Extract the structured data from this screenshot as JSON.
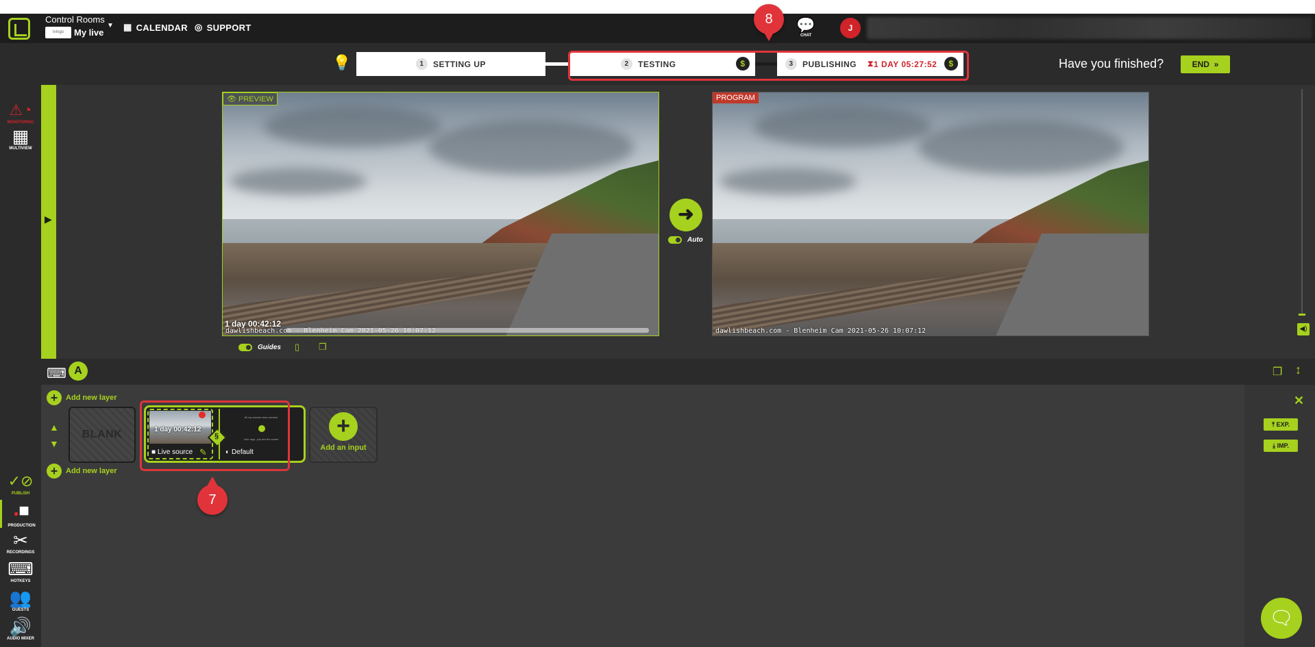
{
  "header": {
    "room_title": "Control Rooms",
    "room_name": "My live",
    "calendar_label": "CALENDAR",
    "support_label": "SUPPORT",
    "chat_label": "CHAT",
    "avatar_initial": "J"
  },
  "steps": [
    {
      "number": "1",
      "label": "SETTING UP"
    },
    {
      "number": "2",
      "label": "TESTING",
      "coin": "$"
    },
    {
      "number": "3",
      "label": "PUBLISHING",
      "timer": "1 DAY 05:27:52",
      "coin": "$"
    }
  ],
  "finish": {
    "question": "Have you finished?",
    "end_label": "END"
  },
  "left_rail": [
    {
      "label": "MONITORING"
    },
    {
      "label": "MULTIVIEW"
    },
    {
      "label": "PUBLISH"
    },
    {
      "label": "PRODUCTION"
    },
    {
      "label": "RECORDINGS"
    },
    {
      "label": "HOTKEYS"
    },
    {
      "label": "GUESTS"
    },
    {
      "label": "AUDIO MIXER"
    }
  ],
  "preview": {
    "tag": "PREVIEW",
    "timer": "1 day 00:42:12",
    "caption": "dawlishbeach.com - Blenheim Cam 2021-05-26 10:07:12"
  },
  "program": {
    "tag": "PROGRAM",
    "caption": "dawlishbeach.com - Blenheim Cam 2021-05-26 10:07:12"
  },
  "controls": {
    "auto_label": "Auto",
    "guides_label": "Guides"
  },
  "layers": {
    "active_layer": "A",
    "add_layer_label": "Add new layer",
    "blank_label": "BLANK",
    "live_tile": {
      "timer": "1 day 00:42:12",
      "source_label": "Live source",
      "overlay_label": "Default",
      "overlay_text_top": "All my scenes here scenes!",
      "overlay_text_bottom": "Your logo, you are the scene"
    },
    "add_input_label": "Add an input"
  },
  "side_panel": {
    "export_label": "EXP.",
    "import_label": "IMP."
  },
  "annotations": {
    "pin_8": "8",
    "pin_7": "7"
  }
}
